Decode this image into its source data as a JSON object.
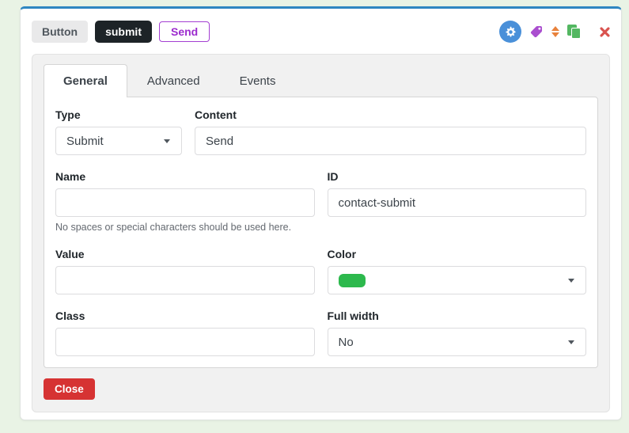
{
  "page": {
    "background_color": "#e9f3e5",
    "accent_border_color": "#2e86c1"
  },
  "toolbar": {
    "element_type_label": "Button",
    "element_name_badge": "submit",
    "element_preview_label": "Send",
    "icons": {
      "settings": {
        "name": "gear-icon",
        "color": "#4a90d9"
      },
      "tag": {
        "name": "tag-icon",
        "color": "#aa4ecf"
      },
      "sort": {
        "name": "sort-arrows-icon",
        "color": "#e8823c"
      },
      "duplicate": {
        "name": "duplicate-icon",
        "color": "#53b761"
      },
      "delete": {
        "name": "delete-x-icon",
        "color": "#d9534f"
      }
    }
  },
  "tabs": [
    {
      "label": "General",
      "active": true
    },
    {
      "label": "Advanced",
      "active": false
    },
    {
      "label": "Events",
      "active": false
    }
  ],
  "form": {
    "type": {
      "label": "Type",
      "value": "Submit"
    },
    "content": {
      "label": "Content",
      "value": "Send"
    },
    "name": {
      "label": "Name",
      "value": "",
      "helper": "No spaces or special characters should be used here."
    },
    "id": {
      "label": "ID",
      "value": "contact-submit"
    },
    "value": {
      "label": "Value",
      "value": ""
    },
    "color": {
      "label": "Color",
      "swatch_color": "#2db94d"
    },
    "class": {
      "label": "Class",
      "value": ""
    },
    "full_width": {
      "label": "Full width",
      "value": "No"
    }
  },
  "footer": {
    "close_label": "Close",
    "close_color": "#d63333"
  }
}
